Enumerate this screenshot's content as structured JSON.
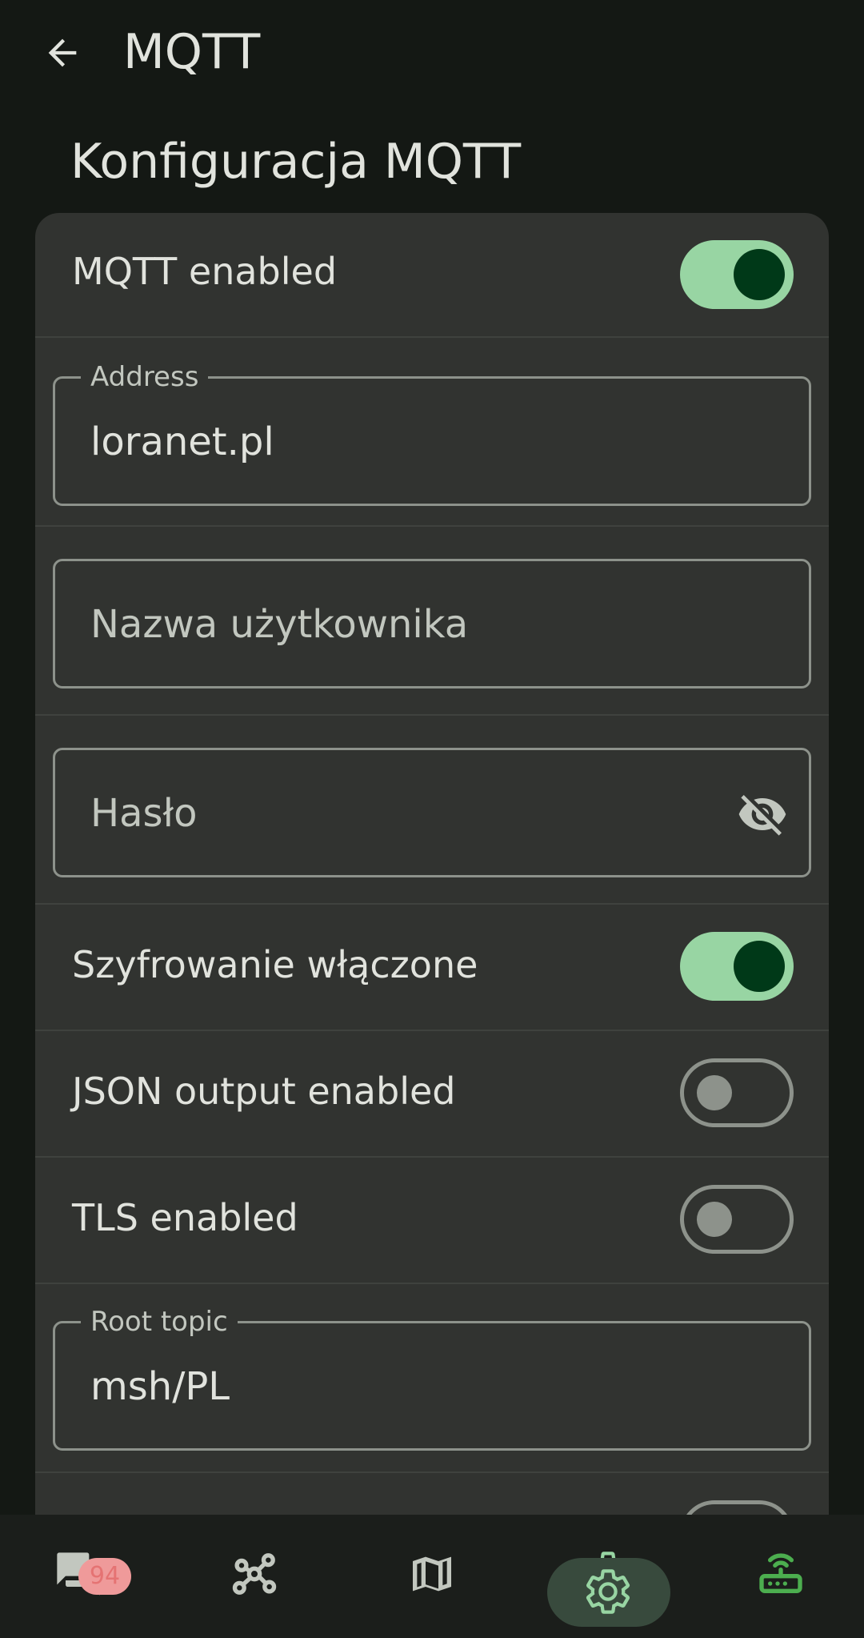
{
  "appbar": {
    "title": "MQTT"
  },
  "section": {
    "title": "Konfiguracja MQTT"
  },
  "settings": {
    "mqtt_enabled": {
      "label": "MQTT enabled",
      "on": true
    },
    "address": {
      "label": "Address",
      "value": "loranet.pl"
    },
    "username": {
      "placeholder": "Nazwa użytkownika"
    },
    "password": {
      "placeholder": "Hasło"
    },
    "encryption": {
      "label": "Szyfrowanie włączone",
      "on": true
    },
    "json_output": {
      "label": "JSON output enabled",
      "on": false
    },
    "tls": {
      "label": "TLS enabled",
      "on": false
    },
    "root_topic": {
      "label": "Root topic",
      "value": "msh/PL"
    }
  },
  "bottom_nav": {
    "items": [
      {
        "name": "messages",
        "icon": "chat-icon",
        "badge": "94"
      },
      {
        "name": "nodes",
        "icon": "network-icon"
      },
      {
        "name": "map",
        "icon": "map-icon"
      },
      {
        "name": "settings",
        "icon": "gear-icon",
        "selected": true
      },
      {
        "name": "connections",
        "icon": "router-wifi-icon"
      }
    ]
  },
  "colors": {
    "background": "#141814",
    "card": "#313330",
    "switch_on_track": "#98d5a3",
    "switch_on_thumb": "#003918",
    "outline": "#8d928b",
    "accent_green": "#4cae4f",
    "badge": "#ef9a9a"
  }
}
